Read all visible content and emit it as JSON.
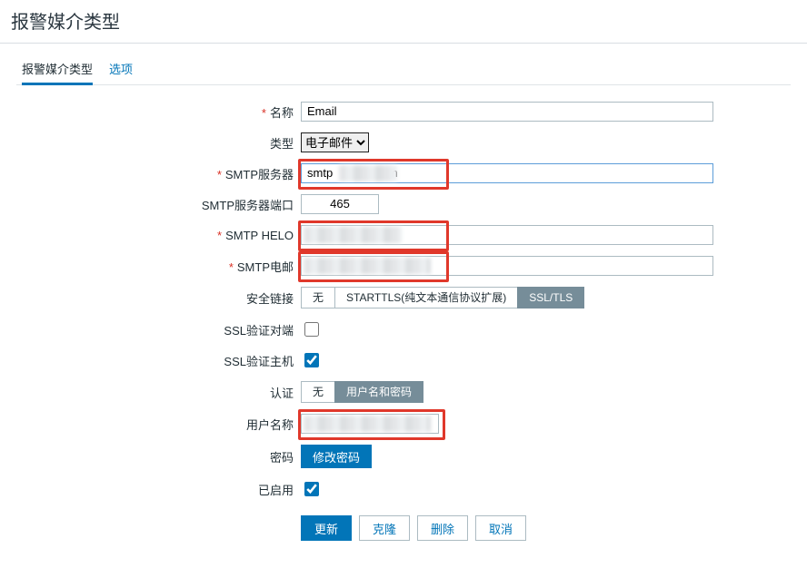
{
  "header": {
    "title": "报警媒介类型"
  },
  "tabs": {
    "items": [
      {
        "label": "报警媒介类型",
        "active": true
      },
      {
        "label": "选项",
        "active": false
      }
    ]
  },
  "form": {
    "name": {
      "label": "名称",
      "value": "Email",
      "required": true
    },
    "type": {
      "label": "类型",
      "value": "电子邮件",
      "options": [
        "电子邮件"
      ]
    },
    "smtp_server": {
      "label": "SMTP服务器",
      "value": "smtp            .com",
      "required": true
    },
    "smtp_port": {
      "label": "SMTP服务器端口",
      "value": "465"
    },
    "smtp_helo": {
      "label": "SMTP HELO",
      "value": "",
      "required": true
    },
    "smtp_email": {
      "label": "SMTP电邮",
      "value": "",
      "required": true
    },
    "connection_security": {
      "label": "安全链接",
      "options": [
        {
          "label": "无",
          "active": false
        },
        {
          "label": "STARTTLS(纯文本通信协议扩展)",
          "active": false
        },
        {
          "label": "SSL/TLS",
          "active": true
        }
      ]
    },
    "ssl_verify_peer": {
      "label": "SSL验证对端",
      "checked": false
    },
    "ssl_verify_host": {
      "label": "SSL验证主机",
      "checked": true
    },
    "authentication": {
      "label": "认证",
      "options": [
        {
          "label": "无",
          "active": false
        },
        {
          "label": "用户名和密码",
          "active": true
        }
      ]
    },
    "username": {
      "label": "用户名称",
      "value": ""
    },
    "password": {
      "label": "密码",
      "change_label": "修改密码"
    },
    "enabled": {
      "label": "已启用",
      "checked": true
    }
  },
  "actions": {
    "update": "更新",
    "clone": "克隆",
    "delete": "删除",
    "cancel": "取消"
  }
}
